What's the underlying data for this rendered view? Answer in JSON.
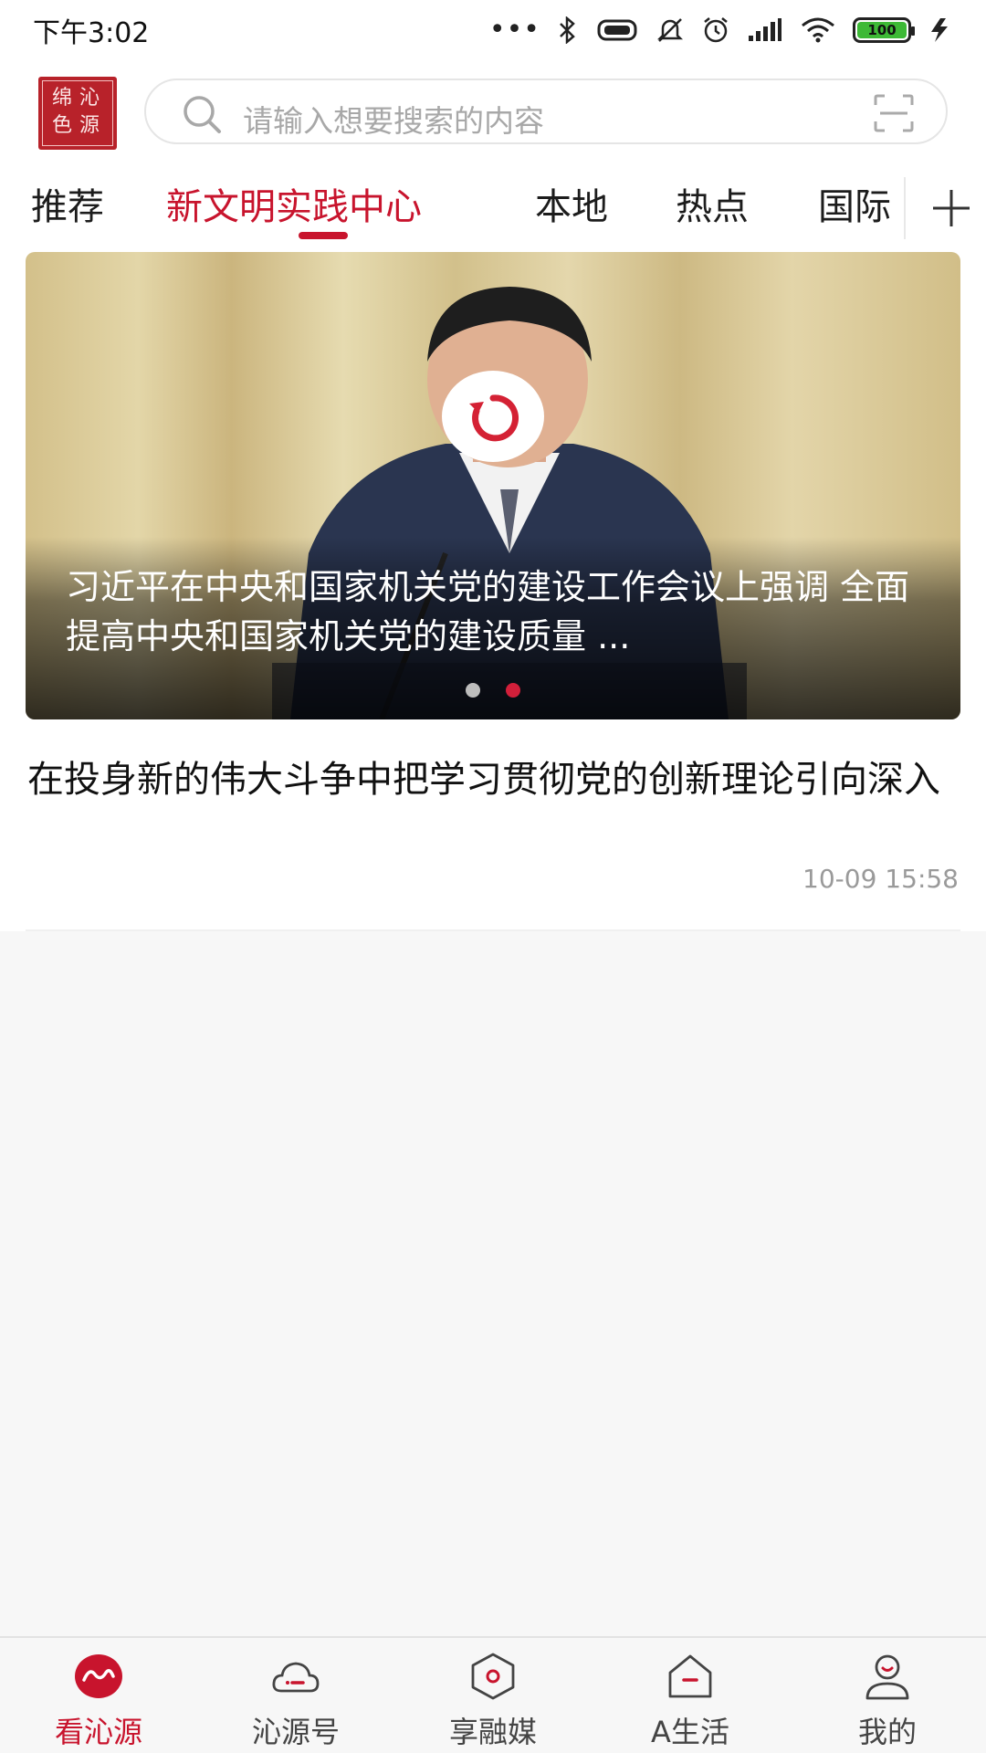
{
  "status_bar": {
    "time": "下午3:02",
    "battery": "100",
    "icons": [
      "more-dots-icon",
      "bluetooth-icon",
      "vibrate-icon",
      "mute-icon",
      "alarm-icon",
      "signal-icon",
      "wifi-icon",
      "battery-icon",
      "charging-icon"
    ]
  },
  "header": {
    "logo_chars": [
      "沁",
      "源",
      "绵",
      "色"
    ],
    "search_placeholder": "请输入想要搜索的内容",
    "icons": [
      "search-icon",
      "scan-icon"
    ]
  },
  "tabs": [
    {
      "label": "推荐",
      "active": false
    },
    {
      "label": "新文明实践中心",
      "active": true
    },
    {
      "label": "本地",
      "active": false
    },
    {
      "label": "热点",
      "active": false
    },
    {
      "label": "国际",
      "active": false
    }
  ],
  "banner": {
    "title": "习近平在中央和国家机关党的建设工作会议上强调 全面提高中央和国家机关党的建设质量 ...",
    "dot_count": 2,
    "active_dot": 2
  },
  "article": {
    "title": "在投身新的伟大斗争中把学习贯彻党的创新理论引向深入",
    "time": "10-09 15:58"
  },
  "bottom_nav": [
    {
      "label": "看沁源",
      "icon": "home-wave-icon",
      "active": true
    },
    {
      "label": "沁源号",
      "icon": "cloud-icon",
      "active": false
    },
    {
      "label": "享融媒",
      "icon": "hexagon-icon",
      "active": false
    },
    {
      "label": "A生活",
      "icon": "house-icon",
      "active": false
    },
    {
      "label": "我的",
      "icon": "user-icon",
      "active": false
    }
  ],
  "colors": {
    "accent": "#c8142d",
    "placeholder": "#a8a8a8",
    "time_text": "#9a9a9a"
  }
}
